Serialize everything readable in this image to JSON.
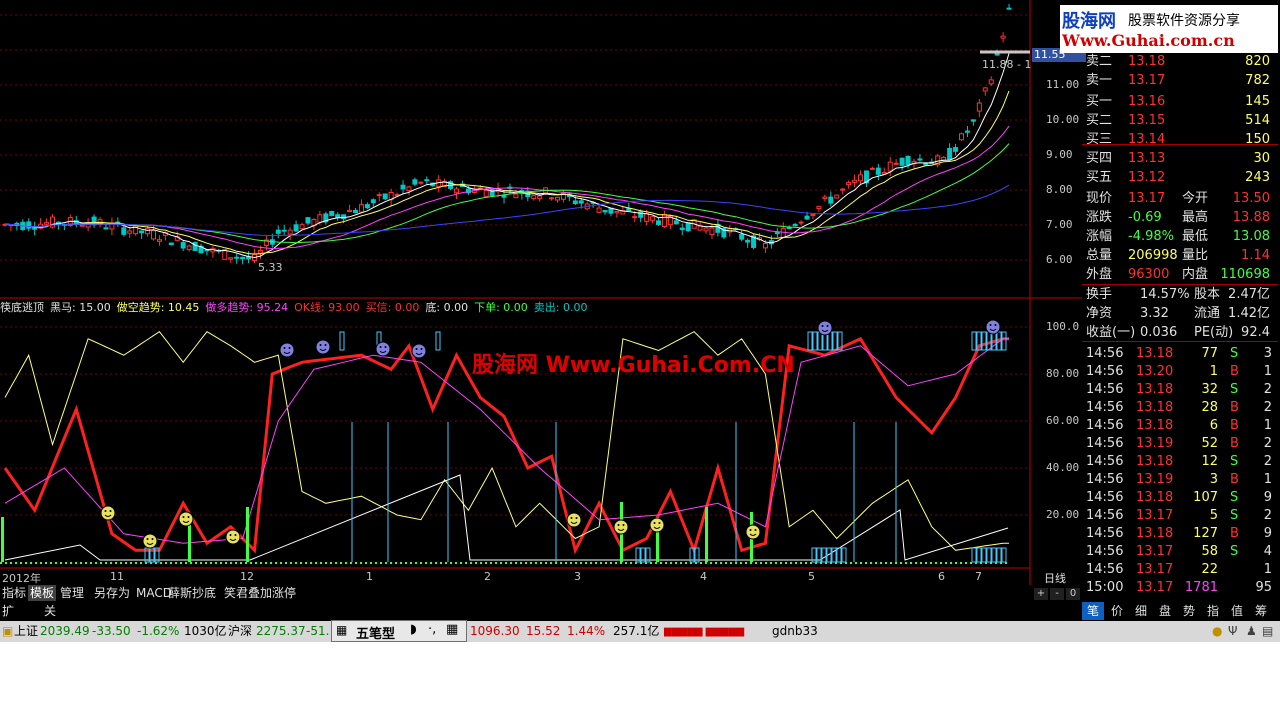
{
  "logo": {
    "line1": "股海网",
    "line1b": "股票软件资源分享",
    "line2": "Www.Guhai.com.cn"
  },
  "watermark": "股海网 Www.Guhai.Com.CN",
  "main_chart": {
    "price_flag": "11.55",
    "annotations": {
      "high_label": "11.88 - 1",
      "low_label": "5.33"
    },
    "y_ticks": [
      "11.00",
      "10.00",
      "9.00",
      "8.00",
      "7.00",
      "6.00"
    ],
    "y_values": [
      11,
      10,
      9,
      8,
      7,
      6
    ],
    "colors": {
      "up": "#ff3030",
      "down": "#00c8c8",
      "ma5": "#ffffff",
      "ma10": "#ffff60",
      "ma20": "#ff40ff",
      "ma30": "#40ff40",
      "ma60": "#4040ff"
    }
  },
  "indicator": {
    "header": [
      {
        "text": "筷底逃顶",
        "color": "#e0e0e0"
      },
      {
        "text": "黑马: 15.00",
        "color": "#e0e0e0"
      },
      {
        "text": "做空趋势: 10.45",
        "color": "#ffff60"
      },
      {
        "text": "做多趋势: 95.24",
        "color": "#ff40ff"
      },
      {
        "text": "OK线: 93.00",
        "color": "#ff3030"
      },
      {
        "text": "买信: 0.00",
        "color": "#ff3030"
      },
      {
        "text": "底: 0.00",
        "color": "#e0e0e0"
      },
      {
        "text": "下单: 0.00",
        "color": "#40ff40"
      },
      {
        "text": "卖出: 0.00",
        "color": "#00c8c8"
      }
    ],
    "y_ticks": [
      "100.0",
      "80.00",
      "60.00",
      "40.00",
      "20.00"
    ],
    "y_values": [
      100,
      80,
      60,
      40,
      20
    ]
  },
  "x_axis": {
    "labels": [
      "2012年",
      "11",
      "12",
      "1",
      "2",
      "3",
      "4",
      "5",
      "6",
      "7"
    ],
    "period": "日线"
  },
  "tabs": [
    "指标",
    "模板",
    "管理",
    "另存为",
    "MACD",
    "薛斯抄底",
    "笑君叠加涨停"
  ],
  "tabs2": [
    "扩展区",
    "关联报价"
  ],
  "quote": {
    "sell": [
      {
        "label": "卖二",
        "price": "13.18",
        "vol": "820"
      },
      {
        "label": "卖一",
        "price": "13.17",
        "vol": "782"
      }
    ],
    "buy": [
      {
        "label": "买一",
        "price": "13.16",
        "vol": "145"
      },
      {
        "label": "买二",
        "price": "13.15",
        "vol": "514"
      },
      {
        "label": "买三",
        "price": "13.14",
        "vol": "150"
      },
      {
        "label": "买四",
        "price": "13.13",
        "vol": "30"
      },
      {
        "label": "买五",
        "price": "13.12",
        "vol": "243"
      }
    ],
    "stats": [
      {
        "l1": "现价",
        "v1": "13.17",
        "c1": "#ff3030",
        "l2": "今开",
        "v2": "13.50",
        "c2": "#ff3030"
      },
      {
        "l1": "涨跌",
        "v1": "-0.69",
        "c1": "#40ff40",
        "l2": "最高",
        "v2": "13.88",
        "c2": "#ff3030"
      },
      {
        "l1": "涨幅",
        "v1": "-4.98%",
        "c1": "#40ff40",
        "l2": "最低",
        "v2": "13.08",
        "c2": "#40ff40"
      },
      {
        "l1": "总量",
        "v1": "206998",
        "c1": "#ffff60",
        "l2": "量比",
        "v2": "1.14",
        "c2": "#ff3030"
      },
      {
        "l1": "外盘",
        "v1": "96300",
        "c1": "#ff3030",
        "l2": "内盘",
        "v2": "110698",
        "c2": "#40ff40"
      }
    ],
    "fund": [
      {
        "l1": "换手",
        "v1": "14.57%",
        "l2": "股本",
        "v2": "2.47亿"
      },
      {
        "l1": "净资",
        "v1": "3.32",
        "l2": "流通",
        "v2": "1.42亿"
      },
      {
        "l1": "收益(一)",
        "v1": "0.036",
        "l2": "PE(动)",
        "v2": "92.4"
      }
    ],
    "ticks": [
      {
        "t": "14:56",
        "p": "13.18",
        "v": "77",
        "s": "S",
        "n": "3"
      },
      {
        "t": "14:56",
        "p": "13.20",
        "v": "1",
        "s": "B",
        "n": "1"
      },
      {
        "t": "14:56",
        "p": "13.18",
        "v": "32",
        "s": "S",
        "n": "2"
      },
      {
        "t": "14:56",
        "p": "13.18",
        "v": "28",
        "s": "B",
        "n": "2"
      },
      {
        "t": "14:56",
        "p": "13.18",
        "v": "6",
        "s": "B",
        "n": "1"
      },
      {
        "t": "14:56",
        "p": "13.19",
        "v": "52",
        "s": "B",
        "n": "2"
      },
      {
        "t": "14:56",
        "p": "13.18",
        "v": "12",
        "s": "S",
        "n": "2"
      },
      {
        "t": "14:56",
        "p": "13.19",
        "v": "3",
        "s": "B",
        "n": "1"
      },
      {
        "t": "14:56",
        "p": "13.18",
        "v": "107",
        "s": "S",
        "n": "9"
      },
      {
        "t": "14:56",
        "p": "13.17",
        "v": "5",
        "s": "S",
        "n": "2"
      },
      {
        "t": "14:56",
        "p": "13.18",
        "v": "127",
        "s": "B",
        "n": "9"
      },
      {
        "t": "14:56",
        "p": "13.17",
        "v": "58",
        "s": "S",
        "n": "4"
      },
      {
        "t": "14:56",
        "p": "13.17",
        "v": "22",
        "s": "",
        "n": "1"
      },
      {
        "t": "15:00",
        "p": "13.17",
        "v": "1781",
        "s": "",
        "n": "95"
      }
    ],
    "right_tabs": [
      "笔",
      "价",
      "细",
      "盘",
      "势",
      "指",
      "值",
      "筹"
    ]
  },
  "statusbar": {
    "sh_label": "上证",
    "sh_value": "2039.49",
    "sh_change": "-33.50",
    "sh_pct": "-1.62%",
    "sh_amount": "1030亿",
    "hs_label": "沪深",
    "hs_value": "2275.37",
    "hs_change": "-51.",
    "ime_label": "五笔型",
    "cy_value": "1096.30",
    "cy_change": "15.52",
    "cy_pct": "1.44%",
    "cy_amount": "257.1亿",
    "user": "gdnb33"
  }
}
